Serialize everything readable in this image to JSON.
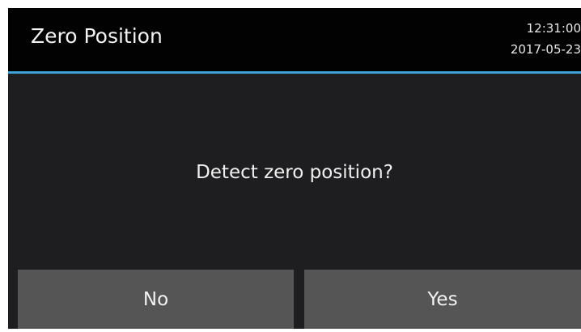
{
  "header": {
    "title": "Zero Position",
    "time": "12:31:00",
    "date": "2017-05-23"
  },
  "dialog": {
    "message": "Detect zero position?",
    "no_label": "No",
    "yes_label": "Yes"
  },
  "colors": {
    "accent": "#3fa0d6",
    "background": "#1e1e20",
    "titlebar": "#020202",
    "button": "#555556"
  }
}
